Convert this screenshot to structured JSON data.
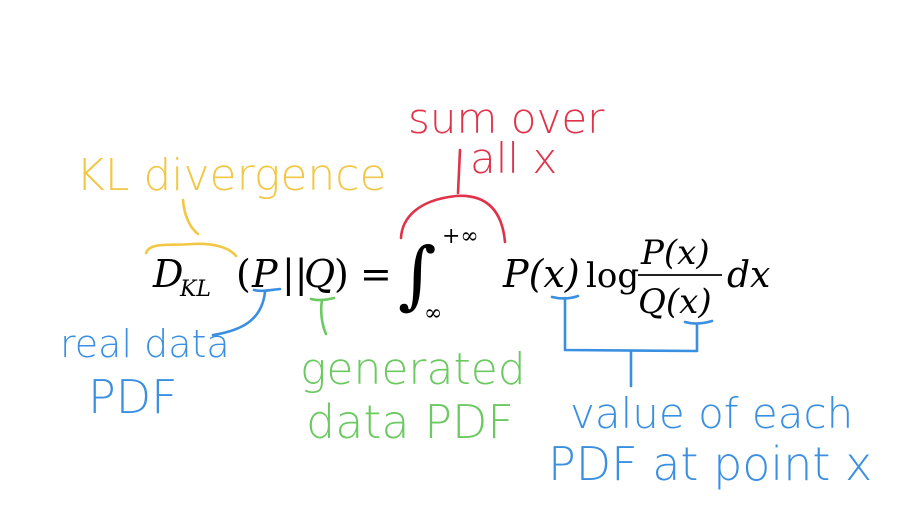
{
  "formula": {
    "d": "D",
    "kl_subscript": "KL",
    "open_paren": "(",
    "p": "P",
    "bars": "||",
    "q": "Q",
    "close_paren": ")",
    "equals": "=",
    "integral": "∫",
    "upper_limit": "+∞",
    "lower_limit": "∞",
    "px": "P(x)",
    "log": "log",
    "numerator": "P(x)",
    "denominator": "Q(x)",
    "dx": "dx"
  },
  "annotations": {
    "kl_divergence": {
      "text": "KL divergence",
      "color": "#f2c744"
    },
    "sum_over": {
      "line1": "sum over",
      "line2": "all x",
      "color": "#e0334a"
    },
    "real_data_pdf": {
      "line1": "real data",
      "line2": "PDF",
      "color": "#3a8fe0"
    },
    "generated_data_pdf": {
      "line1": "generated",
      "line2": "data PDF",
      "color": "#6cc961"
    },
    "value_of_each_pdf": {
      "line1": "value of each",
      "line2": "PDF at point x",
      "color": "#3a8fe0"
    }
  }
}
